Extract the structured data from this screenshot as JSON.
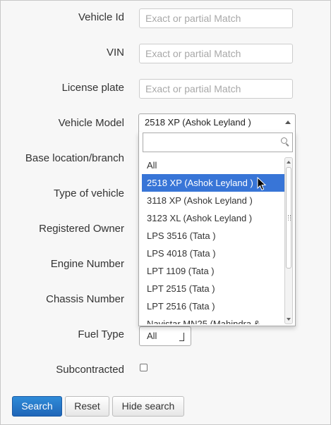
{
  "form": {
    "vehicle_id": {
      "label": "Vehicle Id",
      "placeholder": "Exact or partial Match"
    },
    "vin": {
      "label": "VIN",
      "placeholder": "Exact or partial Match"
    },
    "license_plate": {
      "label": "License plate",
      "placeholder": "Exact or partial Match"
    },
    "vehicle_model": {
      "label": "Vehicle Model",
      "selected": "2518 XP (Ashok Leyland )"
    },
    "base_location": {
      "label": "Base location/branch"
    },
    "type_of_vehicle": {
      "label": "Type of vehicle"
    },
    "registered_owner": {
      "label": "Registered Owner"
    },
    "engine_number": {
      "label": "Engine Number"
    },
    "chassis_number": {
      "label": "Chassis Number"
    },
    "fuel_type": {
      "label": "Fuel Type",
      "selected": "All"
    },
    "subcontracted": {
      "label": "Subcontracted",
      "checked": false
    }
  },
  "dropdown": {
    "search_value": "",
    "options": [
      "All",
      "2518 XP (Ashok Leyland )",
      "3118 XP (Ashok Leyland )",
      "3123 XL (Ashok Leyland )",
      "LPS 3516 (Tata )",
      "LPS 4018 (Tata )",
      "LPT 1109 (Tata )",
      "LPT 2515 (Tata )",
      "LPT 2516 (Tata )",
      "Navistar MN25 (Mahindra &"
    ],
    "highlighted_index": 1
  },
  "buttons": {
    "search": "Search",
    "reset": "Reset",
    "hide_search": "Hide search"
  },
  "colors": {
    "primary": "#2a7fd4",
    "highlight": "#3875d7"
  }
}
